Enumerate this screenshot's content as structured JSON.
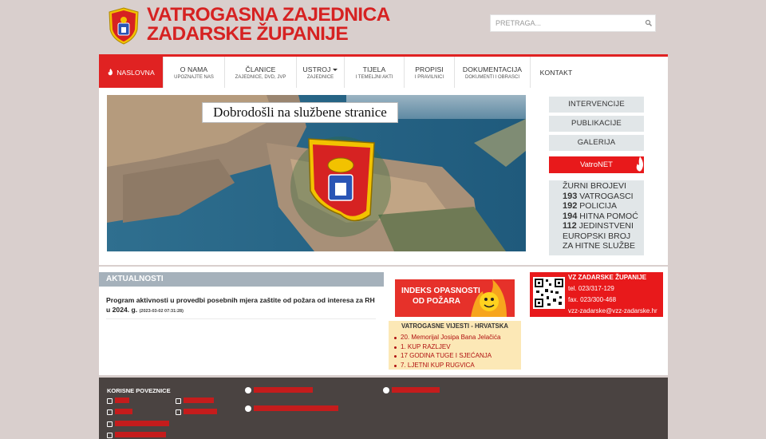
{
  "header": {
    "title_line1": "VATROGASNA ZAJEDNICA",
    "title_line2": "ZADARSKE ŽUPANIJE",
    "search_placeholder": "PRETRAGA..."
  },
  "nav": [
    {
      "label": "NASLOVNA",
      "sub": ""
    },
    {
      "label": "O NAMA",
      "sub": "UPOZNAJTE NAS"
    },
    {
      "label": "ČLANICE",
      "sub": "ZAJEDNICE, DVD, JVP"
    },
    {
      "label": "USTROJ",
      "sub": "ZAJEDNICE"
    },
    {
      "label": "TIJELA",
      "sub": "I TEMELJNI AKTI"
    },
    {
      "label": "PROPISI",
      "sub": "I PRAVILNICI"
    },
    {
      "label": "DOKUMENTACIJA",
      "sub": "DOKUMENTI I OBRASCI"
    },
    {
      "label": "KONTAKT",
      "sub": ""
    }
  ],
  "hero": {
    "welcome": "Dobrodošli na službene stranice"
  },
  "sidebar": {
    "buttons": [
      "INTERVENCIJE",
      "PUBLIKACIJE",
      "GALERIJA"
    ],
    "vatronet": "VatroNET",
    "emergency_title": "ŽURNI BROJEVI",
    "emergency": [
      {
        "num": "193",
        "label": "VATROGASCI"
      },
      {
        "num": "192",
        "label": "POLICIJA"
      },
      {
        "num": "194",
        "label": "HITNA POMOĆ"
      },
      {
        "num": "112",
        "label": "JEDINSTVENI"
      }
    ],
    "emergency_extra1": "EUROPSKI BROJ",
    "emergency_extra2": "ZA HITNE SLUŽBE"
  },
  "news": {
    "heading": "AKTUALNOSTI",
    "item_title": "Program aktivnosti u provedbi posebnih mjera zaštite od požara od interesa za RH u 2024. g.",
    "item_date": "(2023-03-02 07:31:28)"
  },
  "fire_index": {
    "line1": "INDEKS OPASNOSTI",
    "line2": "OD POŽARA"
  },
  "vijesti": {
    "title": "VATROGASNE VIJESTI - HRVATSKA",
    "items": [
      "20. Memorijal Josipa Bana Jelačića",
      "1. KUP RAZLJEV",
      "17 GODINA TUGE I SJEĆANJA",
      "7. LJETNI KUP RUGVICA"
    ]
  },
  "contact": {
    "name": "VZ ZADARSKE ŽUPANIJE",
    "tel": "tel. 023/317-129",
    "fax": "fax. 023/300-468",
    "email": "vzz-zadarske@vzz-zadarske.hr"
  },
  "footer": {
    "heading": "KORISNE POVEZNICE"
  },
  "colors": {
    "accent": "#e02222",
    "nav_bg": "#ffffff",
    "footer_bg": "#4a4341"
  }
}
